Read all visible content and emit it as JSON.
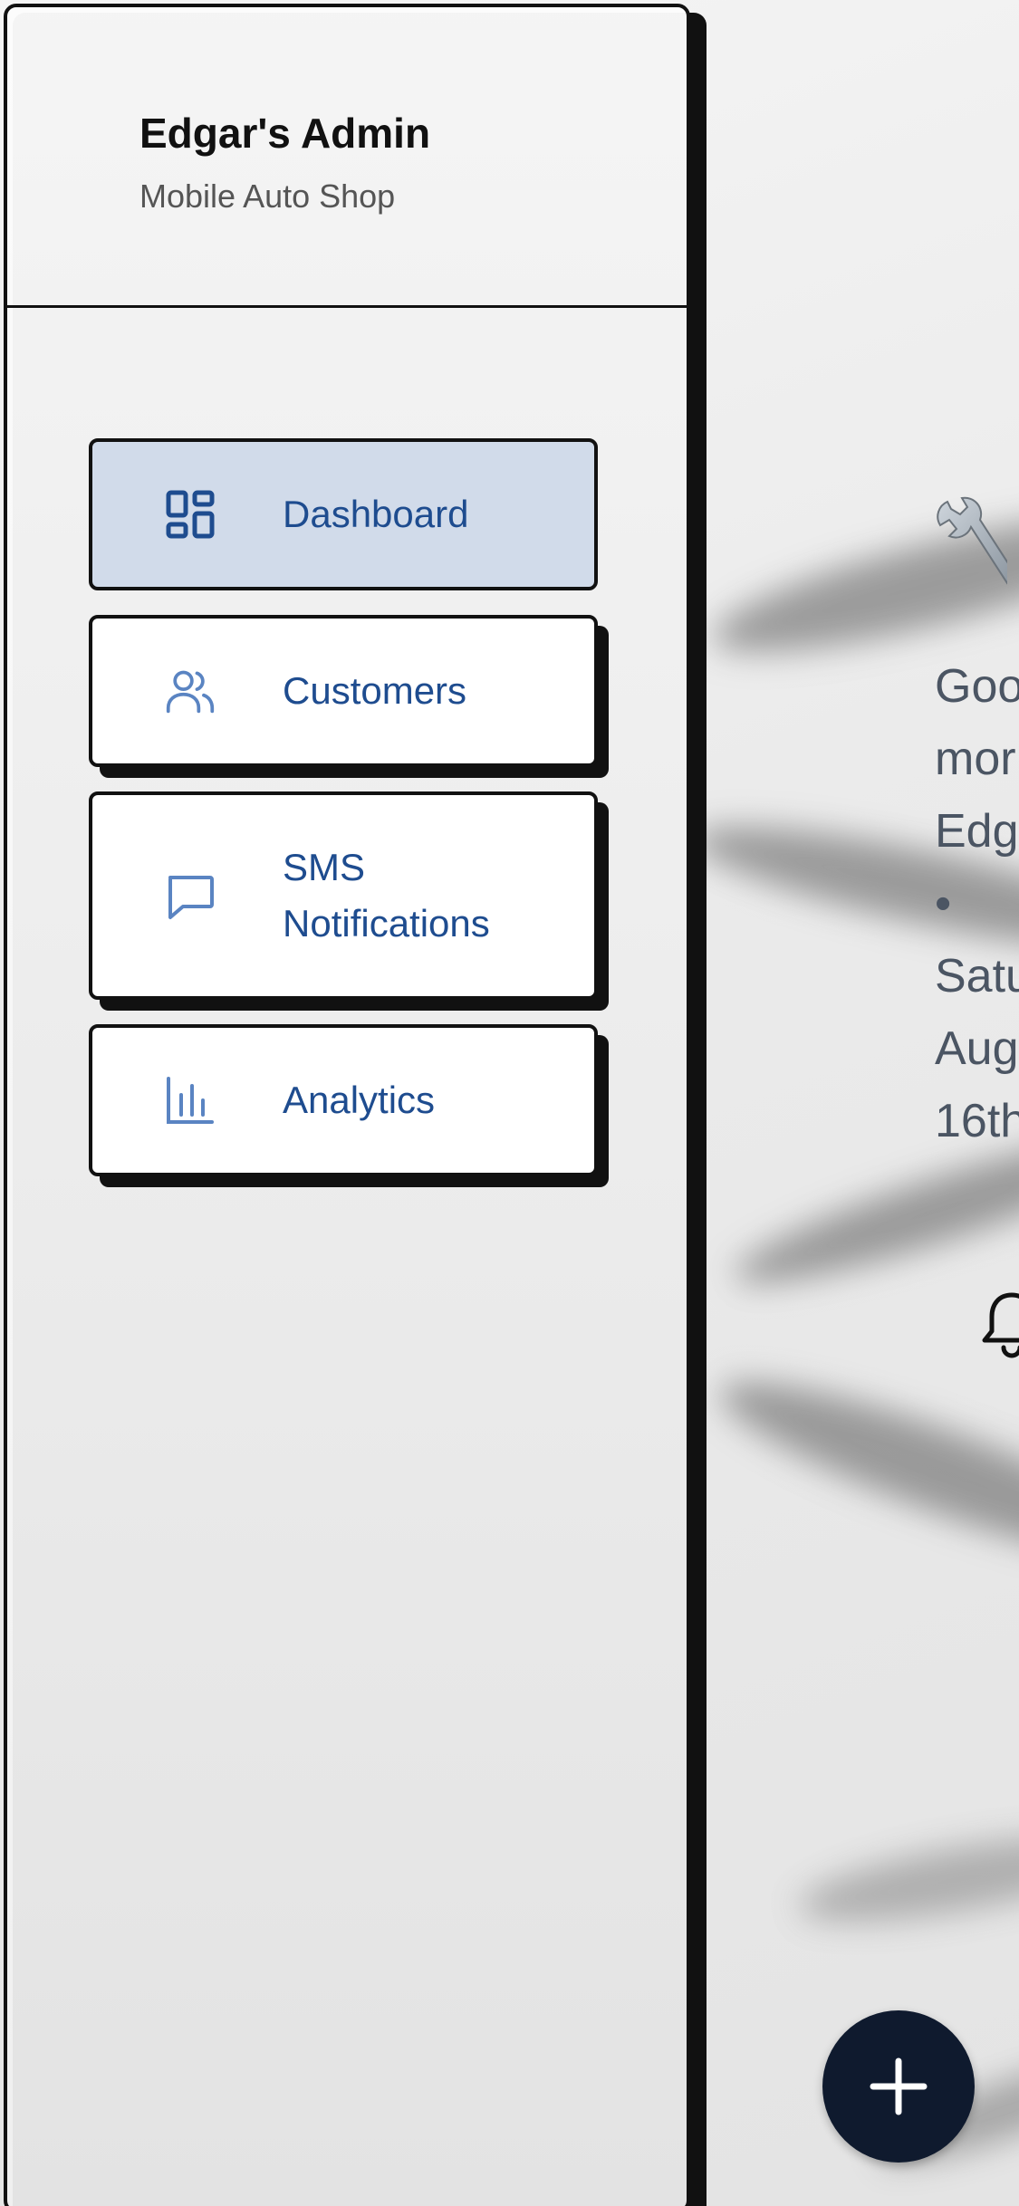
{
  "sidebar": {
    "title": "Edgar's Admin",
    "subtitle": "Mobile Auto Shop",
    "items": [
      {
        "label": "Dashboard",
        "icon": "dashboard-icon",
        "active": true
      },
      {
        "label": "Customers",
        "icon": "users-icon",
        "active": false
      },
      {
        "label": "SMS\nNotifications",
        "icon": "message-icon",
        "active": false
      },
      {
        "label": "Analytics",
        "icon": "bar-chart-icon",
        "active": false
      }
    ]
  },
  "main": {
    "greeting": "Goo\nmor\nEdg\n•\nSatu\nAug\n16th",
    "fab_icon": "plus-icon"
  },
  "colors": {
    "accent": "#1e4c8f",
    "active_bg": "#d1dbea",
    "fab_bg": "#0f1a2e",
    "border": "#111111"
  }
}
